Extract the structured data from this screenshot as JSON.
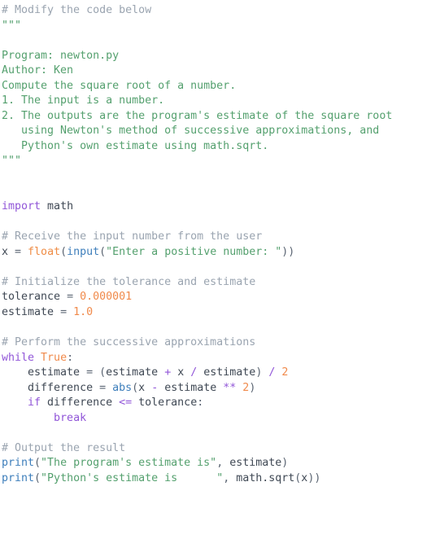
{
  "editor": {
    "language": "python",
    "filename": "newton.py",
    "background_color": "#ffffff",
    "font_size_px": 13.3,
    "line_height_px": 18.55,
    "colors": {
      "comment": "#9aa4b0",
      "string": "#54a06e",
      "keyword": "#9156d8",
      "builtin": "#3d7ebb",
      "number": "#f08a4b",
      "constant": "#f08a4b",
      "function": "#ef8c45",
      "operator": "#9156d8",
      "plain": "#3f4854",
      "punctuation": "#5a6472"
    }
  },
  "lines": [
    {
      "n": 1,
      "tokens": [
        {
          "t": "comment",
          "s": "# Modify the code below"
        }
      ]
    },
    {
      "n": 2,
      "tokens": [
        {
          "t": "string",
          "s": "\"\"\""
        }
      ]
    },
    {
      "n": 3,
      "tokens": [
        {
          "t": "string",
          "s": ""
        }
      ]
    },
    {
      "n": 4,
      "tokens": [
        {
          "t": "string",
          "s": "Program: newton.py"
        }
      ]
    },
    {
      "n": 5,
      "tokens": [
        {
          "t": "string",
          "s": "Author: Ken"
        }
      ]
    },
    {
      "n": 6,
      "tokens": [
        {
          "t": "string",
          "s": "Compute the square root of a number."
        }
      ]
    },
    {
      "n": 7,
      "tokens": [
        {
          "t": "string",
          "s": "1. The input is a number."
        }
      ]
    },
    {
      "n": 8,
      "tokens": [
        {
          "t": "string",
          "s": "2. The outputs are the program's estimate of the square root"
        }
      ]
    },
    {
      "n": 9,
      "tokens": [
        {
          "t": "string",
          "s": "   using Newton's method of successive approximations, and"
        }
      ]
    },
    {
      "n": 10,
      "tokens": [
        {
          "t": "string",
          "s": "   Python's own estimate using math.sqrt."
        }
      ]
    },
    {
      "n": 11,
      "tokens": [
        {
          "t": "string",
          "s": "\"\"\""
        }
      ]
    },
    {
      "n": 12,
      "tokens": [
        {
          "t": "plain",
          "s": ""
        }
      ]
    },
    {
      "n": 13,
      "tokens": [
        {
          "t": "plain",
          "s": ""
        }
      ]
    },
    {
      "n": 14,
      "tokens": [
        {
          "t": "keyword",
          "s": "import"
        },
        {
          "t": "plain",
          "s": " math"
        }
      ]
    },
    {
      "n": 15,
      "tokens": [
        {
          "t": "plain",
          "s": ""
        }
      ]
    },
    {
      "n": 16,
      "tokens": [
        {
          "t": "comment",
          "s": "# Receive the input number from the user"
        }
      ]
    },
    {
      "n": 17,
      "tokens": [
        {
          "t": "plain",
          "s": "x "
        },
        {
          "t": "punct",
          "s": "="
        },
        {
          "t": "plain",
          "s": " "
        },
        {
          "t": "func",
          "s": "float"
        },
        {
          "t": "punct",
          "s": "("
        },
        {
          "t": "builtin",
          "s": "input"
        },
        {
          "t": "punct",
          "s": "("
        },
        {
          "t": "string",
          "s": "\"Enter a positive number: \""
        },
        {
          "t": "punct",
          "s": "))"
        }
      ]
    },
    {
      "n": 18,
      "tokens": [
        {
          "t": "plain",
          "s": ""
        }
      ]
    },
    {
      "n": 19,
      "tokens": [
        {
          "t": "comment",
          "s": "# Initialize the tolerance and estimate"
        }
      ]
    },
    {
      "n": 20,
      "tokens": [
        {
          "t": "plain",
          "s": "tolerance "
        },
        {
          "t": "punct",
          "s": "="
        },
        {
          "t": "plain",
          "s": " "
        },
        {
          "t": "number",
          "s": "0.000001"
        }
      ]
    },
    {
      "n": 21,
      "tokens": [
        {
          "t": "plain",
          "s": "estimate "
        },
        {
          "t": "punct",
          "s": "="
        },
        {
          "t": "plain",
          "s": " "
        },
        {
          "t": "number",
          "s": "1.0"
        }
      ]
    },
    {
      "n": 22,
      "tokens": [
        {
          "t": "plain",
          "s": ""
        }
      ]
    },
    {
      "n": 23,
      "tokens": [
        {
          "t": "comment",
          "s": "# Perform the successive approximations"
        }
      ]
    },
    {
      "n": 24,
      "tokens": [
        {
          "t": "keyword",
          "s": "while"
        },
        {
          "t": "plain",
          "s": " "
        },
        {
          "t": "const",
          "s": "True"
        },
        {
          "t": "punct",
          "s": ":"
        }
      ]
    },
    {
      "n": 25,
      "tokens": [
        {
          "t": "plain",
          "s": "    estimate "
        },
        {
          "t": "punct",
          "s": "="
        },
        {
          "t": "plain",
          "s": " "
        },
        {
          "t": "punct",
          "s": "("
        },
        {
          "t": "plain",
          "s": "estimate "
        },
        {
          "t": "op",
          "s": "+"
        },
        {
          "t": "plain",
          "s": " x "
        },
        {
          "t": "op",
          "s": "/"
        },
        {
          "t": "plain",
          "s": " estimate"
        },
        {
          "t": "punct",
          "s": ")"
        },
        {
          "t": "plain",
          "s": " "
        },
        {
          "t": "op",
          "s": "/"
        },
        {
          "t": "plain",
          "s": " "
        },
        {
          "t": "number",
          "s": "2"
        }
      ]
    },
    {
      "n": 26,
      "tokens": [
        {
          "t": "plain",
          "s": "    difference "
        },
        {
          "t": "punct",
          "s": "="
        },
        {
          "t": "plain",
          "s": " "
        },
        {
          "t": "builtin",
          "s": "abs"
        },
        {
          "t": "punct",
          "s": "("
        },
        {
          "t": "plain",
          "s": "x "
        },
        {
          "t": "op",
          "s": "-"
        },
        {
          "t": "plain",
          "s": " estimate "
        },
        {
          "t": "op",
          "s": "**"
        },
        {
          "t": "plain",
          "s": " "
        },
        {
          "t": "number",
          "s": "2"
        },
        {
          "t": "punct",
          "s": ")"
        }
      ]
    },
    {
      "n": 27,
      "tokens": [
        {
          "t": "plain",
          "s": "    "
        },
        {
          "t": "keyword",
          "s": "if"
        },
        {
          "t": "plain",
          "s": " difference "
        },
        {
          "t": "op",
          "s": "<="
        },
        {
          "t": "plain",
          "s": " tolerance"
        },
        {
          "t": "punct",
          "s": ":"
        }
      ]
    },
    {
      "n": 28,
      "tokens": [
        {
          "t": "plain",
          "s": "        "
        },
        {
          "t": "keyword",
          "s": "break"
        }
      ]
    },
    {
      "n": 29,
      "tokens": [
        {
          "t": "plain",
          "s": ""
        }
      ]
    },
    {
      "n": 30,
      "tokens": [
        {
          "t": "comment",
          "s": "# Output the result"
        }
      ]
    },
    {
      "n": 31,
      "tokens": [
        {
          "t": "builtin",
          "s": "print"
        },
        {
          "t": "punct",
          "s": "("
        },
        {
          "t": "string",
          "s": "\"The program's estimate is\""
        },
        {
          "t": "punct",
          "s": ","
        },
        {
          "t": "plain",
          "s": " estimate"
        },
        {
          "t": "punct",
          "s": ")"
        }
      ]
    },
    {
      "n": 32,
      "tokens": [
        {
          "t": "builtin",
          "s": "print"
        },
        {
          "t": "punct",
          "s": "("
        },
        {
          "t": "string",
          "s": "\"Python's estimate is      \""
        },
        {
          "t": "punct",
          "s": ","
        },
        {
          "t": "plain",
          "s": " math.sqrt"
        },
        {
          "t": "punct",
          "s": "("
        },
        {
          "t": "plain",
          "s": "x"
        },
        {
          "t": "punct",
          "s": "))"
        }
      ]
    }
  ],
  "source_text": "# Modify the code below\n\"\"\"\n\nProgram: newton.py\nAuthor: Ken\nCompute the square root of a number.\n1. The input is a number.\n2. The outputs are the program's estimate of the square root\n   using Newton's method of successive approximations, and\n   Python's own estimate using math.sqrt.\n\"\"\"\n\n\nimport math\n\n# Receive the input number from the user\nx = float(input(\"Enter a positive number: \"))\n\n# Initialize the tolerance and estimate\ntolerance = 0.000001\nestimate = 1.0\n\n# Perform the successive approximations\nwhile True:\n    estimate = (estimate + x / estimate) / 2\n    difference = abs(x - estimate ** 2)\n    if difference <= tolerance:\n        break\n\n# Output the result\nprint(\"The program's estimate is\", estimate)\nprint(\"Python's estimate is      \", math.sqrt(x))"
}
